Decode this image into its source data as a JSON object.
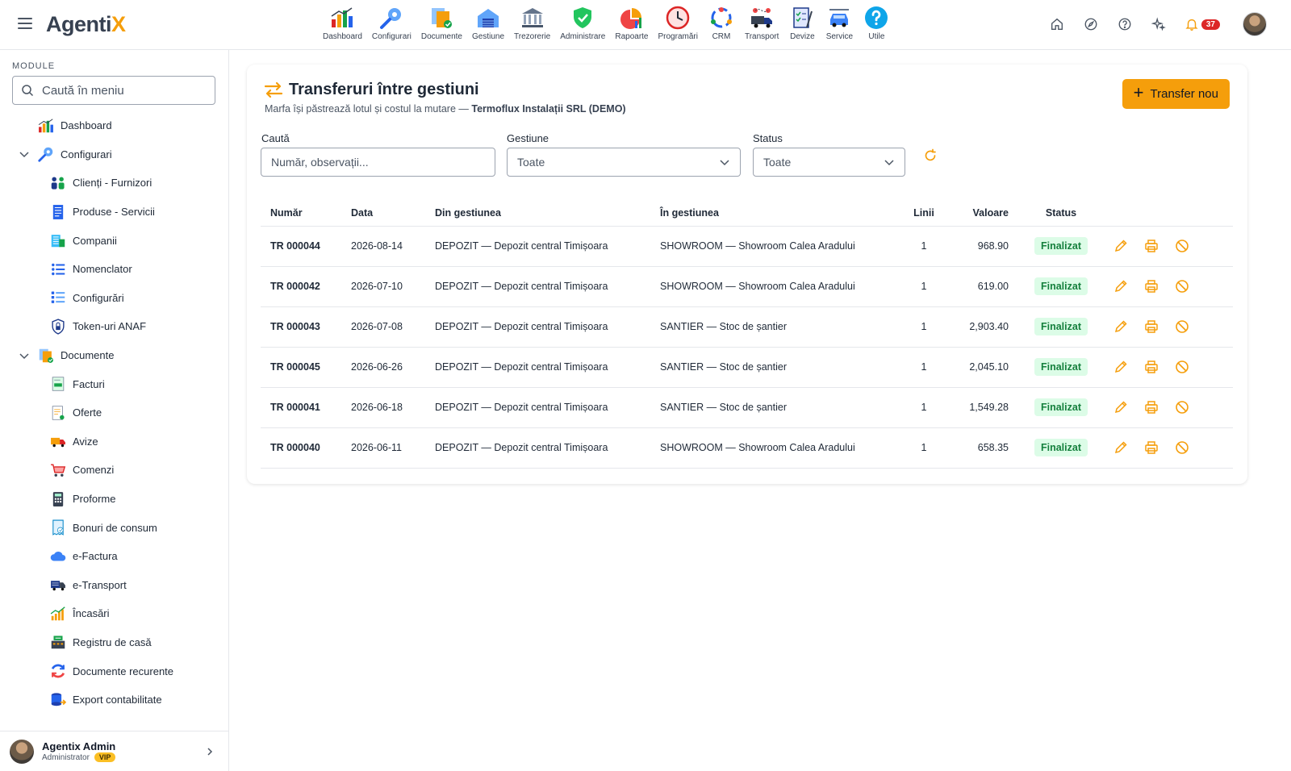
{
  "app": {
    "logo_main": "Agenti",
    "logo_accent": "X"
  },
  "modules": [
    {
      "label": "Dashboard",
      "icon": "dashboard-icon"
    },
    {
      "label": "Configurari",
      "icon": "wrench-gear-icon"
    },
    {
      "label": "Documente",
      "icon": "documents-icon"
    },
    {
      "label": "Gestiune",
      "icon": "warehouse-icon"
    },
    {
      "label": "Trezorerie",
      "icon": "bank-icon"
    },
    {
      "label": "Administrare",
      "icon": "shield-check-icon"
    },
    {
      "label": "Rapoarte",
      "icon": "report-chart-icon"
    },
    {
      "label": "Programări",
      "icon": "clock-icon"
    },
    {
      "label": "CRM",
      "icon": "crm-cycle-icon"
    },
    {
      "label": "Transport",
      "icon": "truck-route-icon"
    },
    {
      "label": "Devize",
      "icon": "checklist-icon"
    },
    {
      "label": "Service",
      "icon": "car-service-icon"
    },
    {
      "label": "Utile",
      "icon": "help-circle-icon"
    }
  ],
  "topright": {
    "notifications_count": "37"
  },
  "sidebar": {
    "heading": "MODULE",
    "search_placeholder": "Caută în meniu",
    "items": [
      {
        "label": "Dashboard",
        "icon": "dashboard-icon",
        "type": "top"
      },
      {
        "label": "Configurari",
        "icon": "wrench-gear-icon",
        "type": "group"
      },
      {
        "label": "Clienți - Furnizori",
        "icon": "people-icon",
        "type": "child"
      },
      {
        "label": "Produse - Servicii",
        "icon": "product-list-icon",
        "type": "child"
      },
      {
        "label": "Companii",
        "icon": "building-icon",
        "type": "child"
      },
      {
        "label": "Nomenclator",
        "icon": "list-icon",
        "type": "child"
      },
      {
        "label": "Configurări",
        "icon": "settings-list-icon",
        "type": "child"
      },
      {
        "label": "Token-uri ANAF",
        "icon": "shield-lock-icon",
        "type": "child"
      },
      {
        "label": "Documente",
        "icon": "documents-icon",
        "type": "group"
      },
      {
        "label": "Facturi",
        "icon": "invoice-icon",
        "type": "child"
      },
      {
        "label": "Oferte",
        "icon": "offer-icon",
        "type": "child"
      },
      {
        "label": "Avize",
        "icon": "delivery-truck-icon",
        "type": "child"
      },
      {
        "label": "Comenzi",
        "icon": "cart-icon",
        "type": "child"
      },
      {
        "label": "Proforme",
        "icon": "calculator-icon",
        "type": "child"
      },
      {
        "label": "Bonuri de consum",
        "icon": "receipt-icon",
        "type": "child"
      },
      {
        "label": "e-Factura",
        "icon": "cloud-icon",
        "type": "child"
      },
      {
        "label": "e-Transport",
        "icon": "transport-truck-icon",
        "type": "child"
      },
      {
        "label": "Încasări",
        "icon": "growth-chart-icon",
        "type": "child"
      },
      {
        "label": "Registru de casă",
        "icon": "cash-register-icon",
        "type": "child"
      },
      {
        "label": "Documente recurente",
        "icon": "recurring-icon",
        "type": "child"
      },
      {
        "label": "Export contabilitate",
        "icon": "database-export-icon",
        "type": "child"
      }
    ]
  },
  "user": {
    "name": "Agentix Admin",
    "role": "Administrator",
    "badge": "VIP"
  },
  "page": {
    "title": "Transferuri între gestiuni",
    "subtitle_prefix": "Marfa își păstrează lotul și costul la mutare — ",
    "subtitle_company": "Termoflux Instalații SRL (DEMO)",
    "new_button": "Transfer nou"
  },
  "filters": {
    "search_label": "Caută",
    "search_placeholder": "Număr, observații...",
    "gestiune_label": "Gestiune",
    "gestiune_value": "Toate",
    "status_label": "Status",
    "status_value": "Toate"
  },
  "table": {
    "headers": [
      "Număr",
      "Data",
      "Din gestiunea",
      "În gestiunea",
      "Linii",
      "Valoare",
      "Status"
    ],
    "rows": [
      {
        "number": "TR 000044",
        "date": "2026-08-14",
        "from": "DEPOZIT — Depozit central Timișoara",
        "to": "SHOWROOM — Showroom Calea Aradului",
        "lines": "1",
        "value": "968.90",
        "status": "Finalizat"
      },
      {
        "number": "TR 000042",
        "date": "2026-07-10",
        "from": "DEPOZIT — Depozit central Timișoara",
        "to": "SHOWROOM — Showroom Calea Aradului",
        "lines": "1",
        "value": "619.00",
        "status": "Finalizat"
      },
      {
        "number": "TR 000043",
        "date": "2026-07-08",
        "from": "DEPOZIT — Depozit central Timișoara",
        "to": "SANTIER — Stoc de șantier",
        "lines": "1",
        "value": "2,903.40",
        "status": "Finalizat"
      },
      {
        "number": "TR 000045",
        "date": "2026-06-26",
        "from": "DEPOZIT — Depozit central Timișoara",
        "to": "SANTIER — Stoc de șantier",
        "lines": "1",
        "value": "2,045.10",
        "status": "Finalizat"
      },
      {
        "number": "TR 000041",
        "date": "2026-06-18",
        "from": "DEPOZIT — Depozit central Timișoara",
        "to": "SANTIER — Stoc de șantier",
        "lines": "1",
        "value": "1,549.28",
        "status": "Finalizat"
      },
      {
        "number": "TR 000040",
        "date": "2026-06-11",
        "from": "DEPOZIT — Depozit central Timișoara",
        "to": "SHOWROOM — Showroom Calea Aradului",
        "lines": "1",
        "value": "658.35",
        "status": "Finalizat"
      }
    ]
  },
  "colors": {
    "accent": "#f59e0b",
    "status_bg": "#dcfce7",
    "status_text": "#15803d",
    "badge": "#dc2626"
  }
}
